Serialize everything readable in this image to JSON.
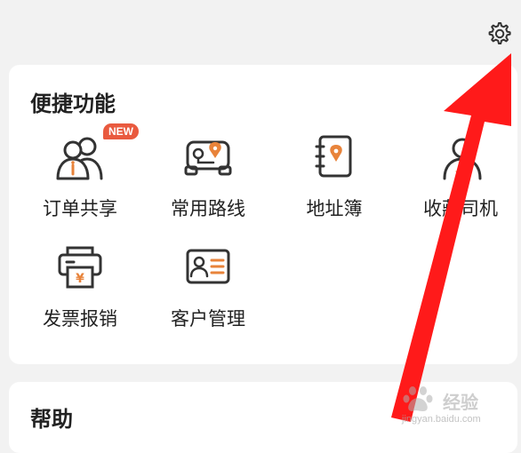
{
  "settings": {
    "icon": "gear-icon"
  },
  "quick_functions": {
    "title": "便捷功能",
    "items": [
      {
        "label": "订单共享",
        "icon": "order-share-icon",
        "badge": "NEW"
      },
      {
        "label": "常用路线",
        "icon": "route-icon"
      },
      {
        "label": "地址簿",
        "icon": "address-book-icon"
      },
      {
        "label": "收藏司机",
        "icon": "favorite-driver-icon"
      },
      {
        "label": "发票报销",
        "icon": "invoice-printer-icon"
      },
      {
        "label": "客户管理",
        "icon": "customer-card-icon"
      }
    ]
  },
  "help": {
    "title": "帮助"
  },
  "watermark": {
    "text": "经验",
    "url": "jingyan.baidu.com"
  },
  "colors": {
    "accent": "#e8833a",
    "badge": "#e95a3f",
    "icon_stroke": "#333333",
    "arrow": "#ff0000"
  }
}
